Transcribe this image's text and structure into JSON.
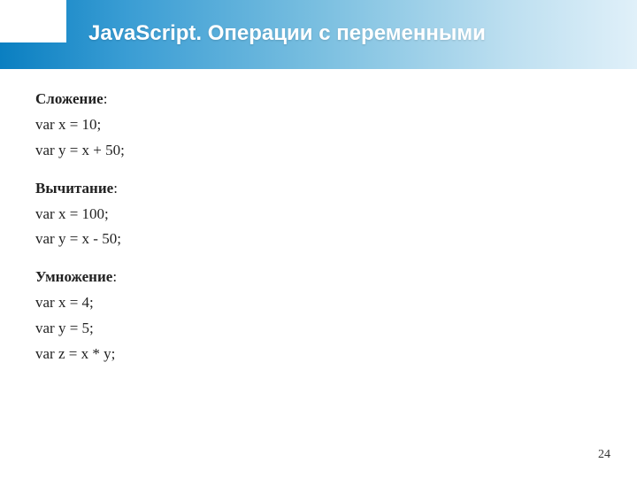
{
  "title": "JavaScript. Операции с переменными",
  "sections": [
    {
      "heading": "Сложение",
      "lines": [
        "var x = 10;",
        "var y = x + 50;"
      ]
    },
    {
      "heading": "Вычитание",
      "lines": [
        "var x = 100;",
        "var y = x - 50;"
      ]
    },
    {
      "heading": "Умножение",
      "lines": [
        "var x = 4;",
        "var y = 5;",
        "var z = x * y;"
      ]
    }
  ],
  "page_number": "24"
}
